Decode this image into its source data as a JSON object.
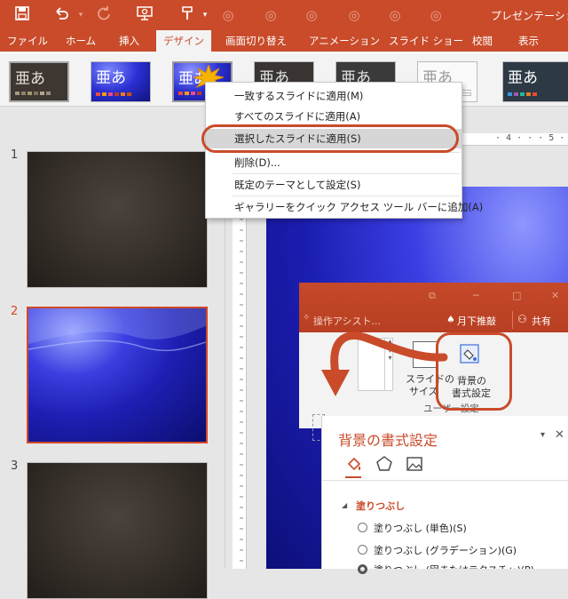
{
  "window": {
    "title": "プレゼンテーション"
  },
  "quick_access": {
    "save_icon": "save-icon",
    "undo_icon": "undo-icon",
    "redo_icon": "redo-icon",
    "present_icon": "present-icon",
    "customize_icon": "customize-icon"
  },
  "tabs": [
    {
      "label": "ファイル"
    },
    {
      "label": "ホーム"
    },
    {
      "label": "挿入"
    },
    {
      "label": "デザイン"
    },
    {
      "label": "画面切り替え"
    },
    {
      "label": "アニメーション"
    },
    {
      "label": "スライド ショー"
    },
    {
      "label": "校閲"
    },
    {
      "label": "表示"
    }
  ],
  "themes": {
    "glyph": "亜あ",
    "colors": {
      "dark": "#3d3631",
      "blue": "#2a2fd2",
      "accent": "#c94b2a"
    }
  },
  "context_menu": {
    "items": [
      {
        "label": "一致するスライドに適用(M)"
      },
      {
        "label": "すべてのスライドに適用(A)"
      },
      {
        "label": "選択したスライドに適用(S)"
      },
      {
        "label": "削除(D)..."
      },
      {
        "label": "既定のテーマとして設定(S)"
      },
      {
        "label": "ギャラリーをクイック アクセス ツール バーに追加(A)"
      }
    ]
  },
  "slides": {
    "numbers": [
      "1",
      "2",
      "3"
    ]
  },
  "ruler": {
    "marks": "· 4 · · · 5 ·"
  },
  "overlay": {
    "assist": "操作アシスト...",
    "user": "月下推敲",
    "share": "共有",
    "slide_size_label_1": "スライドの",
    "slide_size_label_2": "サイズ",
    "format_bg_label_1": "背景の",
    "format_bg_label_2": "書式設定",
    "group_label": "ユーザー設定",
    "pane_title": "背景の書式設定",
    "section_fill": "塗りつぶし",
    "options": [
      {
        "label": "塗りつぶし (単色)(S)"
      },
      {
        "label": "塗りつぶし (グラデーション)(G)"
      },
      {
        "label": "塗りつぶし (図またはテクスチャ)(P)"
      }
    ]
  }
}
